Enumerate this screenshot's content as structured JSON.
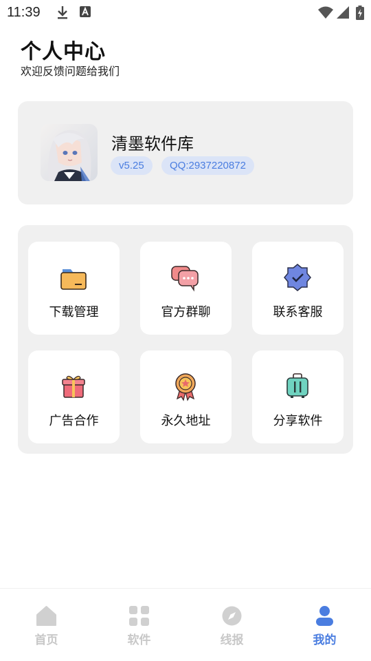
{
  "status_bar": {
    "time": "11:39",
    "icons": [
      "download-icon",
      "a-icon",
      "wifi-icon",
      "signal-icon",
      "battery-icon"
    ]
  },
  "header": {
    "title": "个人中心",
    "subtitle": "欢迎反馈问题给我们"
  },
  "profile": {
    "name": "清墨软件库",
    "version": "v5.25",
    "qq": "QQ:2937220872",
    "badge_bg": "#dbe4f7",
    "badge_color": "#4a7de0"
  },
  "grid": {
    "items": [
      {
        "label": "下载管理",
        "icon": "folder-icon"
      },
      {
        "label": "官方群聊",
        "icon": "chat-bubbles-icon"
      },
      {
        "label": "联系客服",
        "icon": "verified-badge-icon"
      },
      {
        "label": "广告合作",
        "icon": "gift-icon"
      },
      {
        "label": "永久地址",
        "icon": "medal-icon"
      },
      {
        "label": "分享软件",
        "icon": "suitcase-icon"
      }
    ]
  },
  "bottom_nav": {
    "items": [
      {
        "label": "首页",
        "icon": "home-icon",
        "active": false
      },
      {
        "label": "软件",
        "icon": "apps-grid-icon",
        "active": false
      },
      {
        "label": "线报",
        "icon": "compass-icon",
        "active": false
      },
      {
        "label": "我的",
        "icon": "user-icon",
        "active": true
      }
    ],
    "active_color": "#4a7de0",
    "inactive_color": "#c8c8c8"
  }
}
